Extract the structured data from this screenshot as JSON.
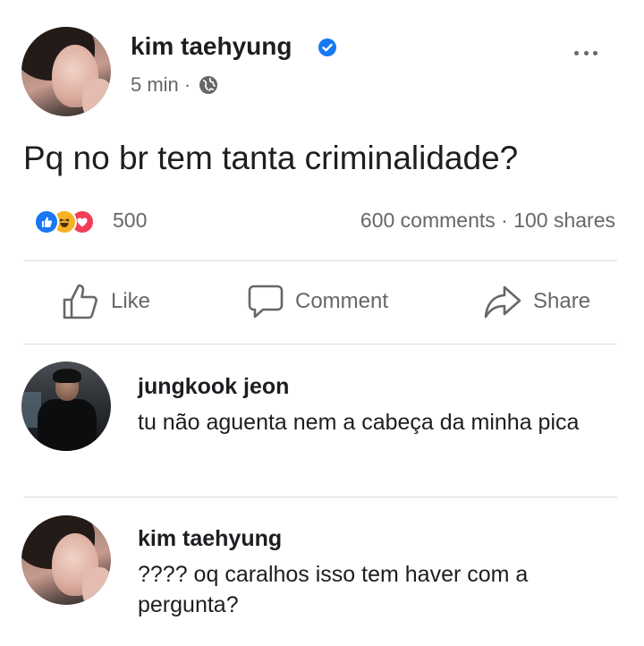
{
  "post": {
    "author": "kim taehyung",
    "time": "5 min ·",
    "text": "Pq no br tem tanta criminalidade?",
    "reaction_count": "500",
    "counts": "600 comments · 100 shares",
    "reactions": [
      "like-icon",
      "haha-icon",
      "love-icon"
    ],
    "accent_color": "#1877f2"
  },
  "actions": {
    "like": "Like",
    "comment": "Comment",
    "share": "Share"
  },
  "comments": [
    {
      "name": "jungkook jeon",
      "text": "tu não aguenta nem a cabeça da minha pica"
    },
    {
      "name": "kim taehyung",
      "text": "???? oq caralhos isso tem haver com a pergunta?"
    }
  ]
}
